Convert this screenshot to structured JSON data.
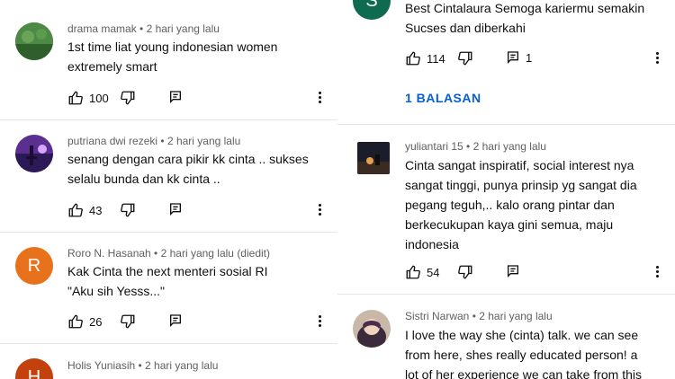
{
  "left": [
    {
      "author": "drama mamak",
      "time": "2 hari yang lalu",
      "lines": [
        "1st time liat young indonesian women",
        "extremely smart"
      ],
      "likes": "100"
    },
    {
      "author": "putriana dwi rezeki",
      "time": "2 hari yang lalu",
      "lines": [
        "senang dengan cara pikir kk cinta .. sukses",
        "selalu bunda dan kk cinta .."
      ],
      "likes": "43"
    },
    {
      "author": "Roro N. Hasanah",
      "time": "2 hari yang lalu (diedit)",
      "lines": [
        "Kak Cinta the next menteri sosial RI",
        "\"Aku sih Yesss...\""
      ],
      "likes": "26",
      "avatar_letter": "R"
    },
    {
      "author": "Holis Yuniasih",
      "time": "2 hari yang lalu",
      "lines": [],
      "avatar_letter": "H"
    }
  ],
  "right": [
    {
      "avatar_letter": "S",
      "lines": [
        "Best Cintalaura Semoga kariermu semakin",
        "Sucses dan diberkahi"
      ],
      "likes": "114",
      "reply_count": "1",
      "replies_label": "1 BALASAN"
    },
    {
      "author": "yuliantari 15",
      "time": "2 hari yang lalu",
      "lines": [
        "Cinta sangat inspiratif, social interest nya",
        "sangat tinggi, punya prinsip yg sangat dia",
        "pegang teguh,.. kalo orang pintar dan",
        "berkecukupan kaya gini semua, maju",
        "indonesia"
      ],
      "likes": "54"
    },
    {
      "author": "Sistri Narwan",
      "time": "2 hari yang lalu",
      "lines": [
        "I love the way she (cinta) talk. we can see",
        "from here, shes really educated person! a",
        "lot of her experience we can take from this"
      ]
    }
  ],
  "separator": " • ",
  "colors": {
    "avatar_r": "#e8711c",
    "avatar_h": "#c2410c",
    "avatar_s": "#0f6b50",
    "link": "#065fd4"
  }
}
